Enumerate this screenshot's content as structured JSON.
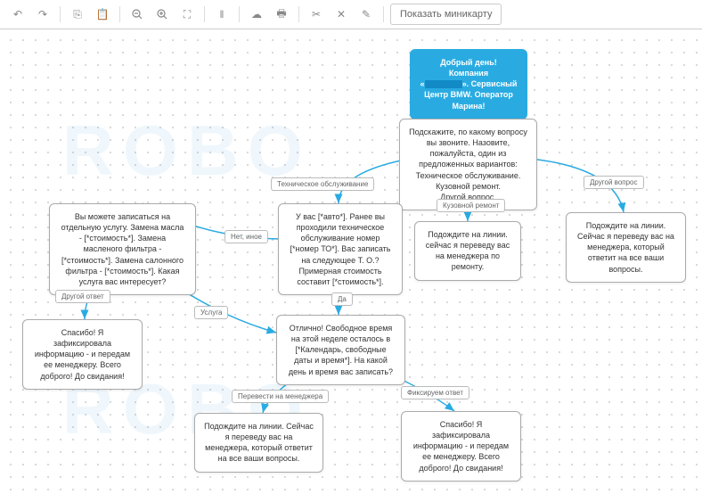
{
  "toolbar": {
    "minimap_btn": "Показать миникарту"
  },
  "nodes": {
    "start_l1": "Добрый день! Компания",
    "start_l2a": "«",
    "start_l2b": "». Сервисный",
    "start_l3": "Центр BMW. Оператор",
    "start_l4": "Марина!",
    "ask": "Подскажите, по какому вопросу вы звоните. Назовите, пожалуйста, один из предложенных вариантов: Техническое обслуживание. Кузовной ремонт.\nДругой вопрос.",
    "hold_mgr": "Подождите на линии. Сейчас я переведу вас на менеджера, который ответит на все ваши вопросы.",
    "hold_repair": "Подождите на линии. сейчас я переведу вас на менеджера по ремонту.",
    "to_info": "У вас [*авто*]. Ранее вы проходили техническое обслуживание номер [*номер ТО*]. Вас  записать на следующее Т. О.? Примерная стоимость составит [*стоимость*].",
    "services": "Вы можете записаться на отдельную услугу. Замена масла - [*стоимость*]. Замена масленого фильтра - [*стоимость*]. Замена салонного фильтра - [*стоимость*]. Какая услуга вас интересует?",
    "schedule": "Отлично! Свободное время на этой неделе осталось в [*Календарь, свободные даты и время*]. На какой день и время вас записать?",
    "thanks": "Спасибо! Я зафиксировала информацию  - и передам ее менеджеру. Всего доброго! До свидания!"
  },
  "edges": {
    "tech": "Техническое обслуживание",
    "body": "Кузовной ремонт",
    "other_q": "Другой вопрос",
    "no_other": "Нет, иное",
    "yes": "Да",
    "other_ans": "Другой ответ",
    "service": "Услуга",
    "to_mgr": "Перевести на менеджера",
    "fix_ans": "Фиксируем ответ"
  },
  "chart_data": {
    "type": "flowchart",
    "nodes": [
      {
        "id": "start",
        "kind": "start",
        "text": "Добрый день! Компания «____». Сервисный Центр BMW. Оператор Марина!"
      },
      {
        "id": "ask",
        "text": "Подскажите, по какому вопросу вы звоните. Назовите, пожалуйста, один из предложенных вариантов: Техническое обслуживание. Кузовной ремонт. Другой вопрос."
      },
      {
        "id": "hold_mgr_right",
        "text": "Подождите на линии. Сейчас я переведу вас на менеджера, который ответит на все ваши вопросы."
      },
      {
        "id": "hold_repair",
        "text": "Подождите на линии. сейчас я переведу вас на менеджера по ремонту."
      },
      {
        "id": "to_info",
        "text": "У вас [*авто*]. Ранее вы проходили техническое обслуживание номер [*номер ТО*]. Вас записать на следующее Т. О.? Примерная стоимость составит [*стоимость*]."
      },
      {
        "id": "services",
        "text": "Вы можете записаться на отдельную услугу. Замена масла - [*стоимость*]. Замена масленого фильтра - [*стоимость*]. Замена салонного фильтра - [*стоимость*]. Какая услуга вас интересует?"
      },
      {
        "id": "schedule",
        "text": "Отлично! Свободное время на этой неделе осталось в [*Календарь, свободные даты и время*]. На какой день и время вас записать?"
      },
      {
        "id": "thanks_left",
        "text": "Спасибо! Я зафиксировала информацию - и передам ее менеджеру. Всего доброго! До свидания!"
      },
      {
        "id": "hold_mgr_bottom",
        "text": "Подождите на линии. Сейчас я переведу вас на менеджера, который ответит на все ваши вопросы."
      },
      {
        "id": "thanks_right",
        "text": "Спасибо! Я зафиксировала информацию - и передам ее менеджеру. Всего доброго! До свидания!"
      }
    ],
    "edges": [
      {
        "from": "start",
        "to": "ask",
        "label": ""
      },
      {
        "from": "ask",
        "to": "to_info",
        "label": "Техническое обслуживание"
      },
      {
        "from": "ask",
        "to": "hold_repair",
        "label": "Кузовной ремонт"
      },
      {
        "from": "ask",
        "to": "hold_mgr_right",
        "label": "Другой вопрос"
      },
      {
        "from": "to_info",
        "to": "services",
        "label": "Нет, иное"
      },
      {
        "from": "to_info",
        "to": "schedule",
        "label": "Да"
      },
      {
        "from": "services",
        "to": "thanks_left",
        "label": "Другой ответ"
      },
      {
        "from": "services",
        "to": "schedule",
        "label": "Услуга"
      },
      {
        "from": "schedule",
        "to": "hold_mgr_bottom",
        "label": "Перевести на менеджера"
      },
      {
        "from": "schedule",
        "to": "thanks_right",
        "label": "Фиксируем ответ"
      }
    ]
  }
}
